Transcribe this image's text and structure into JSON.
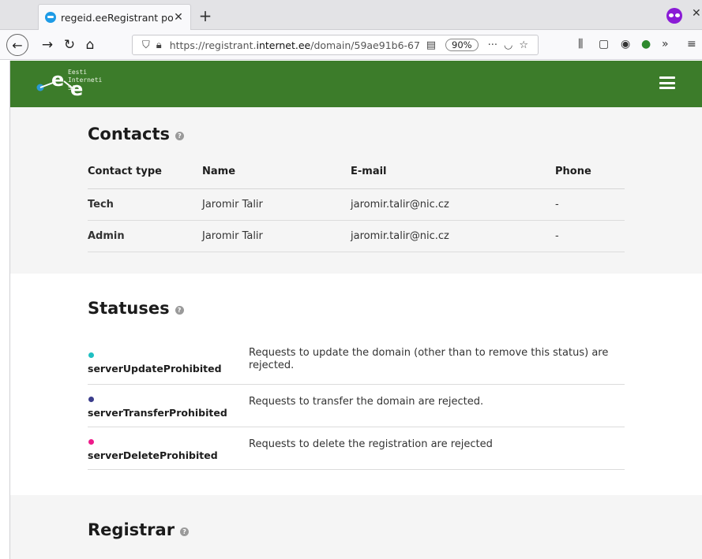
{
  "browser": {
    "tab_title": "regeid.eeRegistrant porta",
    "tab_close": "✕",
    "new_tab": "+",
    "url_prefix": "https://registrant.",
    "url_domain": "internet.ee",
    "url_path": "/domain/59ae91b6-67",
    "zoom": "90%",
    "more_actions": "···"
  },
  "header": {
    "logo_lines": [
      "Eesti",
      "Interneti",
      "SA"
    ],
    "brand_color": "#3c7c2a"
  },
  "contacts": {
    "title": "Contacts",
    "help": "?",
    "columns": [
      "Contact type",
      "Name",
      "E-mail",
      "Phone"
    ],
    "rows": [
      {
        "type": "Tech",
        "name": "Jaromir Talir",
        "email": "jaromir.talir@nic.cz",
        "phone": "-"
      },
      {
        "type": "Admin",
        "name": "Jaromir Talir",
        "email": "jaromir.talir@nic.cz",
        "phone": "-"
      }
    ]
  },
  "statuses": {
    "title": "Statuses",
    "help": "?",
    "items": [
      {
        "name": "serverUpdateProhibited",
        "description": "Requests to update the domain (other than to remove this status) are rejected.",
        "color": "#1fbfc2"
      },
      {
        "name": "serverTransferProhibited",
        "description": "Requests to transfer the domain are rejected.",
        "color": "#3b3d8c"
      },
      {
        "name": "serverDeleteProhibited",
        "description": "Requests to delete the registration are rejected",
        "color": "#ee1a8a"
      }
    ]
  },
  "registrar": {
    "title": "Registrar",
    "help": "?"
  }
}
